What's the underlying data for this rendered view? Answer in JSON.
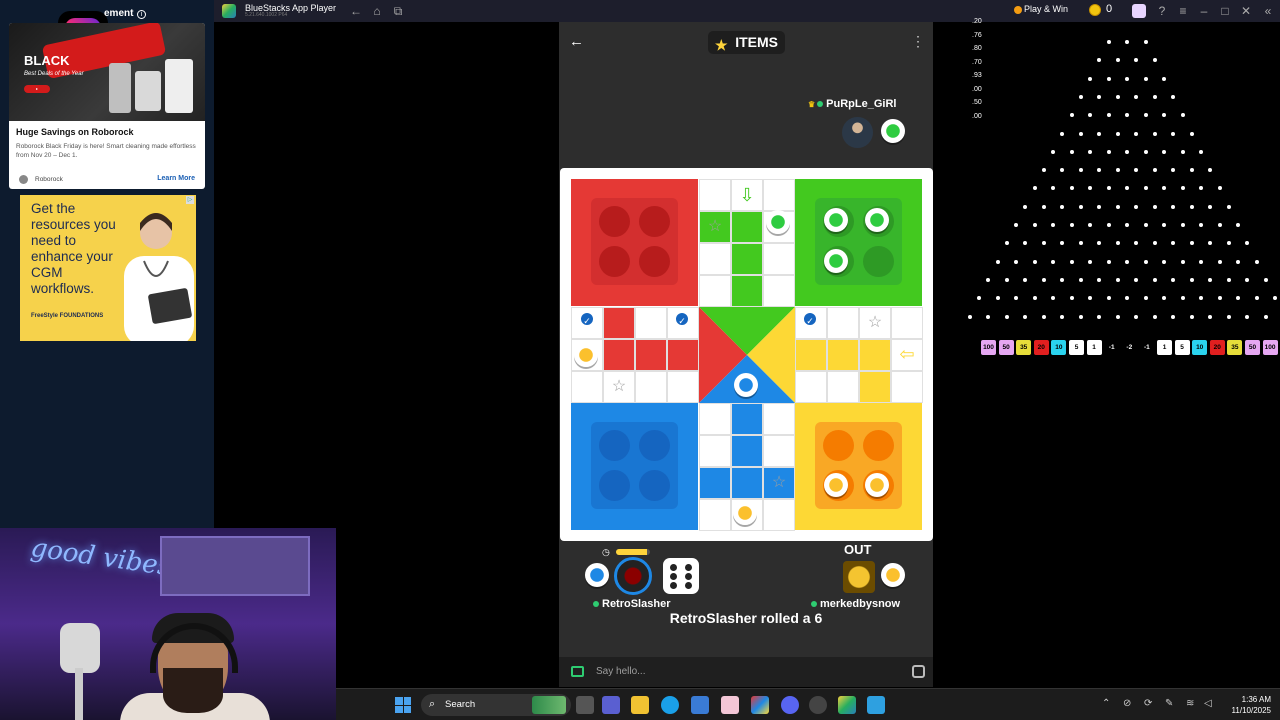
{
  "ads": {
    "sponsored_label": "ement",
    "roborock_title": "Huge Savings on Roborock",
    "roborock_desc": "Roborock Black Friday is here! Smart cleaning made effortless from Nov 20 – Dec 1.",
    "roborock_source": "Roborock",
    "roborock_cta": "Learn More",
    "roborock_hero_brand": "BLACK",
    "roborock_hero_deal": "Best Deals of the Year",
    "cgm_text": "Get the resources you need to enhance your CGM workflows.",
    "cgm_brand": "FreeStyle FOUNDATIONS"
  },
  "bluestacks": {
    "app_name": "BlueStacks App Player",
    "version": "5.21.640.1002 P64",
    "play_win": "Play & Win",
    "coins": "0"
  },
  "plinko": {
    "side_values": [
      "20",
      "76",
      "80",
      "70",
      "93",
      "00",
      "50",
      "00"
    ],
    "multipliers": [
      "100",
      "50",
      "35",
      "20",
      "10",
      "5",
      "1",
      "-1",
      "-2",
      "-1",
      "1",
      "5",
      "10",
      "20",
      "35",
      "50",
      "100"
    ],
    "multiplier_colors": [
      "#e6a7f2",
      "#e6a7f2",
      "#e6dd3a",
      "#e11f1f",
      "#2ad3ee",
      "#ffffff",
      "#ffffff",
      "#000000",
      "#000000",
      "#000000",
      "#ffffff",
      "#ffffff",
      "#2ad3ee",
      "#e11f1f",
      "#e6dd3a",
      "#e6a7f2",
      "#e6a7f2"
    ]
  },
  "game": {
    "items_label": "ITEMS",
    "opponent_top": "PuRpLe_GiRl",
    "player_bottom_left": "RetroSlasher",
    "player_bottom_right": "merkedbysnow",
    "out_label": "OUT",
    "status": "RetroSlasher rolled a 6",
    "dice_value": 6,
    "colors": {
      "red": "#e53935",
      "green": "#43c91f",
      "blue": "#1e88e5",
      "yellow": "#fdd835"
    }
  },
  "chat": {
    "placeholder": "Say hello..."
  },
  "taskbar": {
    "search_label": "Search",
    "time": "1:36 AM",
    "date": "11/10/2025"
  },
  "webcam": {
    "neon_text": "good vibes only"
  }
}
